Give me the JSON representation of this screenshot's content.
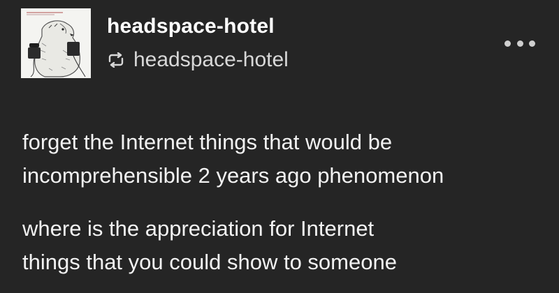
{
  "post": {
    "author": {
      "name": "headspace-hotel",
      "avatar_icon": "bear-with-phones-avatar-icon"
    },
    "reblog": {
      "icon": "reblog-icon",
      "name": "headspace-hotel"
    },
    "more_icon": "more-options-icon",
    "paragraphs": [
      {
        "lines": [
          "forget the Internet things that would be",
          "incomprehensible 2 years ago phenomenon"
        ]
      },
      {
        "lines": [
          "where is the appreciation for Internet",
          "things that you could show to someone"
        ]
      }
    ]
  },
  "colors": {
    "background": "#252525",
    "text": "#f2f2f2",
    "secondary_text": "#d8d8d8"
  }
}
